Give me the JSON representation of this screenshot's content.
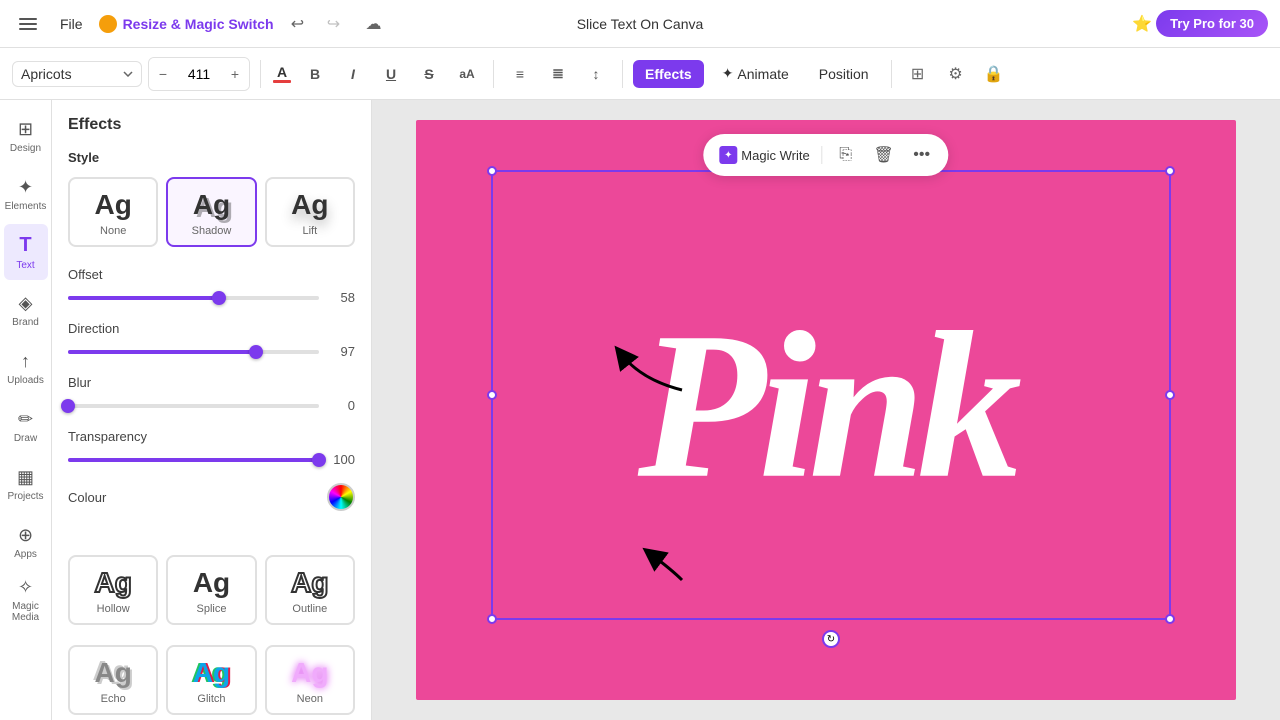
{
  "topbar": {
    "file_label": "File",
    "brand_name": "Resize & Magic Switch",
    "slice_text": "Slice Text On Canva",
    "try_pro": "Try Pro for 30",
    "undo_label": "Undo",
    "redo_label": "Redo"
  },
  "toolbar2": {
    "font_name": "Apricots",
    "font_size": "411",
    "effects_label": "Effects",
    "animate_label": "Animate",
    "position_label": "Position"
  },
  "effects_panel": {
    "title": "Effects",
    "style_section": "Style",
    "styles": [
      {
        "label": "None",
        "type": "none"
      },
      {
        "label": "Shadow",
        "type": "shadow"
      },
      {
        "label": "Lift",
        "type": "lift"
      }
    ],
    "offset_label": "Offset",
    "offset_value": "58",
    "offset_pct": 60,
    "direction_label": "Direction",
    "direction_value": "97",
    "direction_pct": 75,
    "blur_label": "Blur",
    "blur_value": "0",
    "blur_pct": 0,
    "transparency_label": "Transparency",
    "transparency_value": "100",
    "transparency_pct": 100,
    "colour_label": "Colour",
    "styles2": [
      {
        "label": "Hollow",
        "type": "hollow"
      },
      {
        "label": "Splice",
        "type": "splice"
      },
      {
        "label": "Outline",
        "type": "outline"
      },
      {
        "label": "Echo",
        "type": "echo"
      },
      {
        "label": "Glitch",
        "type": "glitch"
      },
      {
        "label": "Neon",
        "type": "neon"
      }
    ]
  },
  "sidebar": {
    "items": [
      {
        "label": "Design",
        "icon": "⊞"
      },
      {
        "label": "Elements",
        "icon": "✦"
      },
      {
        "label": "Text",
        "icon": "T"
      },
      {
        "label": "Brand",
        "icon": "◈"
      },
      {
        "label": "Uploads",
        "icon": "↑"
      },
      {
        "label": "Draw",
        "icon": "✏"
      },
      {
        "label": "Projects",
        "icon": "▦"
      },
      {
        "label": "Apps",
        "icon": "⊕"
      },
      {
        "label": "Magic Media",
        "icon": "✧"
      }
    ]
  },
  "canvas": {
    "text_content": "Pink"
  },
  "magic_write": {
    "label": "Magic Write",
    "copy_label": "Copy",
    "delete_label": "Delete",
    "more_label": "More"
  }
}
